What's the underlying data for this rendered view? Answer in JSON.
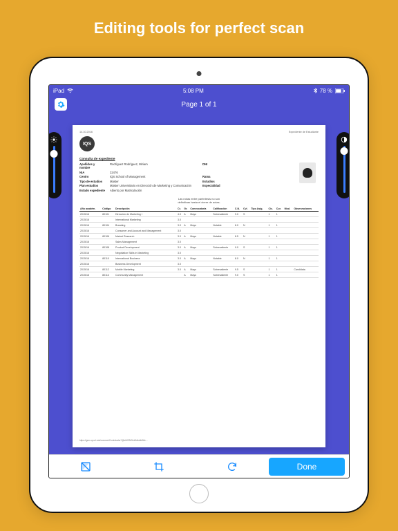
{
  "headline": "Editing tools for perfect scan",
  "statusbar": {
    "carrier": "iPad",
    "wifi": "᭧",
    "time": "5:08 PM",
    "bt": "ᚼ",
    "battery": "78 %"
  },
  "nav": {
    "title": "Page 1 of 1"
  },
  "sliders": {
    "left_icon": "brightness-icon",
    "right_icon": "contrast-icon"
  },
  "toolbar": {
    "contrast_label": "",
    "crop_label": "",
    "rotate_label": "",
    "done_label": "Done"
  },
  "doc": {
    "date": "14.10.2016",
    "header_right": "Expediente de Estudiante",
    "logo_text": "IQS",
    "subtitle": "Consulta de expediente",
    "info": [
      {
        "l1": "Apellidos y nombre",
        "v1": "Rodríguez Rodríguez, Miriam",
        "l2": "DNI",
        "v2": ""
      },
      {
        "l1": "NIA",
        "v1": "32476",
        "l2": "",
        "v2": ""
      },
      {
        "l1": "Centro",
        "v1": "IQS School of Management",
        "l2": "Rama",
        "v2": ""
      },
      {
        "l1": "Tipo de estudios",
        "v1": "Máster",
        "l2": "Estudios",
        "v2": ""
      },
      {
        "l1": "Plan estudios",
        "v1": "Máster Universitario en Dirección de Marketing y Comunicación",
        "l2": "Especialidad",
        "v2": ""
      },
      {
        "l1": "Estado expediente",
        "v1": "Abierto por Matriculación",
        "l2": "",
        "v2": ""
      }
    ],
    "note_l1": "Las notas entre paréntesis no son",
    "note_l2": "definitivas hasta el cierre de actas.",
    "columns": [
      "Año\nacadém.",
      "Código",
      "Descripción",
      "Cr.",
      "Gr.",
      "Convocatoria",
      "Calificación",
      "C.N.",
      "Cvl.",
      "Tipo\nAsig.",
      "Cic.",
      "Cur.",
      "Mod.",
      "Observaciones"
    ],
    "rows": [
      [
        "2015/16",
        "80101",
        "Dirección de Marketing I",
        "4.0",
        "A",
        "Mayo",
        "Sobresaliente",
        "9.0",
        "S",
        "",
        "1",
        "1",
        "",
        ""
      ],
      [
        "2015/16",
        "",
        "International Marketing",
        "3.0",
        "",
        "",
        "",
        "",
        "",
        "",
        "",
        "",
        "",
        ""
      ],
      [
        "2015/16",
        "80104",
        "Branding",
        "3.0",
        "A",
        "Mayo",
        "Notable",
        "8.0",
        "N",
        "",
        "1",
        "1",
        "",
        ""
      ],
      [
        "2015/16",
        "",
        "Consumer and Account and Management",
        "3.0",
        "",
        "",
        "",
        "",
        "",
        "",
        "",
        "",
        "",
        ""
      ],
      [
        "2015/16",
        "80106",
        "Market Research",
        "3.0",
        "A",
        "Mayo",
        "Notable",
        "8.5",
        "N",
        "",
        "1",
        "1",
        "",
        ""
      ],
      [
        "2015/16",
        "",
        "Sales Management",
        "3.0",
        "",
        "",
        "",
        "",
        "",
        "",
        "",
        "",
        "",
        ""
      ],
      [
        "2015/16",
        "80108",
        "Product Development",
        "3.0",
        "A",
        "Mayo",
        "Sobresaliente",
        "9.0",
        "S",
        "",
        "1",
        "1",
        "",
        ""
      ],
      [
        "2015/16",
        "",
        "Negotiation Skills in Marketing",
        "3.0",
        "",
        "",
        "",
        "",
        "",
        "",
        "",
        "",
        "",
        ""
      ],
      [
        "2015/16",
        "80110",
        "International Business",
        "3.0",
        "A",
        "Mayo",
        "Notable",
        "8.0",
        "N",
        "",
        "1",
        "1",
        "",
        ""
      ],
      [
        "2015/16",
        "",
        "Business Development",
        "3.0",
        "",
        "",
        "",
        "",
        "",
        "",
        "",
        "",
        "",
        ""
      ],
      [
        "2015/16",
        "80112",
        "Mobile Marketing",
        "3.0",
        "A",
        "Mayo",
        "Sobresaliente",
        "9.5",
        "S",
        "",
        "1",
        "1",
        "",
        "Candidata"
      ],
      [
        "2015/16",
        "80113",
        "Community Management",
        "",
        "A",
        "Mayo",
        "Sobresaliente",
        "9.0",
        "S",
        "",
        "1",
        "1",
        "",
        ""
      ]
    ],
    "footer_url": "https://gen-up.url.edu/cosmos/Controlador?@ebf2f349eb0dbdfe3bb…"
  }
}
